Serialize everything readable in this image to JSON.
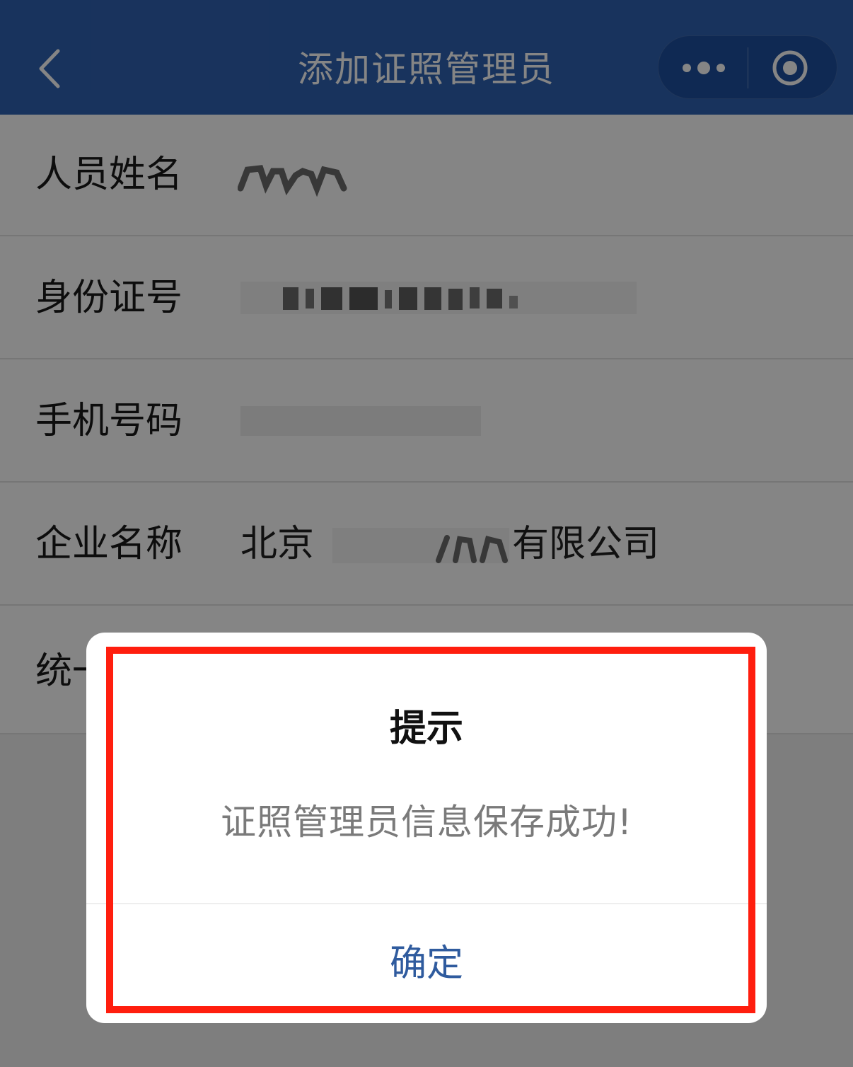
{
  "header": {
    "title": "添加证照管理员",
    "back_icon": "chevron-left-icon",
    "more_icon": "more-dots-icon",
    "close_icon": "target-circle-icon",
    "bg_color": "#2f62b3"
  },
  "form": {
    "rows": [
      {
        "label": "人员姓名",
        "value": ""
      },
      {
        "label": "身份证号",
        "value": ""
      },
      {
        "label": "手机号码",
        "value": ""
      },
      {
        "label": "企业名称",
        "value_prefix": "北京",
        "value_suffix": "有限公司"
      },
      {
        "label": "统一"
      }
    ]
  },
  "dialog": {
    "title": "提示",
    "message": "证照管理员信息保存成功!",
    "confirm_label": "确定",
    "highlight_color": "#ff1e0e",
    "confirm_color": "#2f5b9e"
  }
}
